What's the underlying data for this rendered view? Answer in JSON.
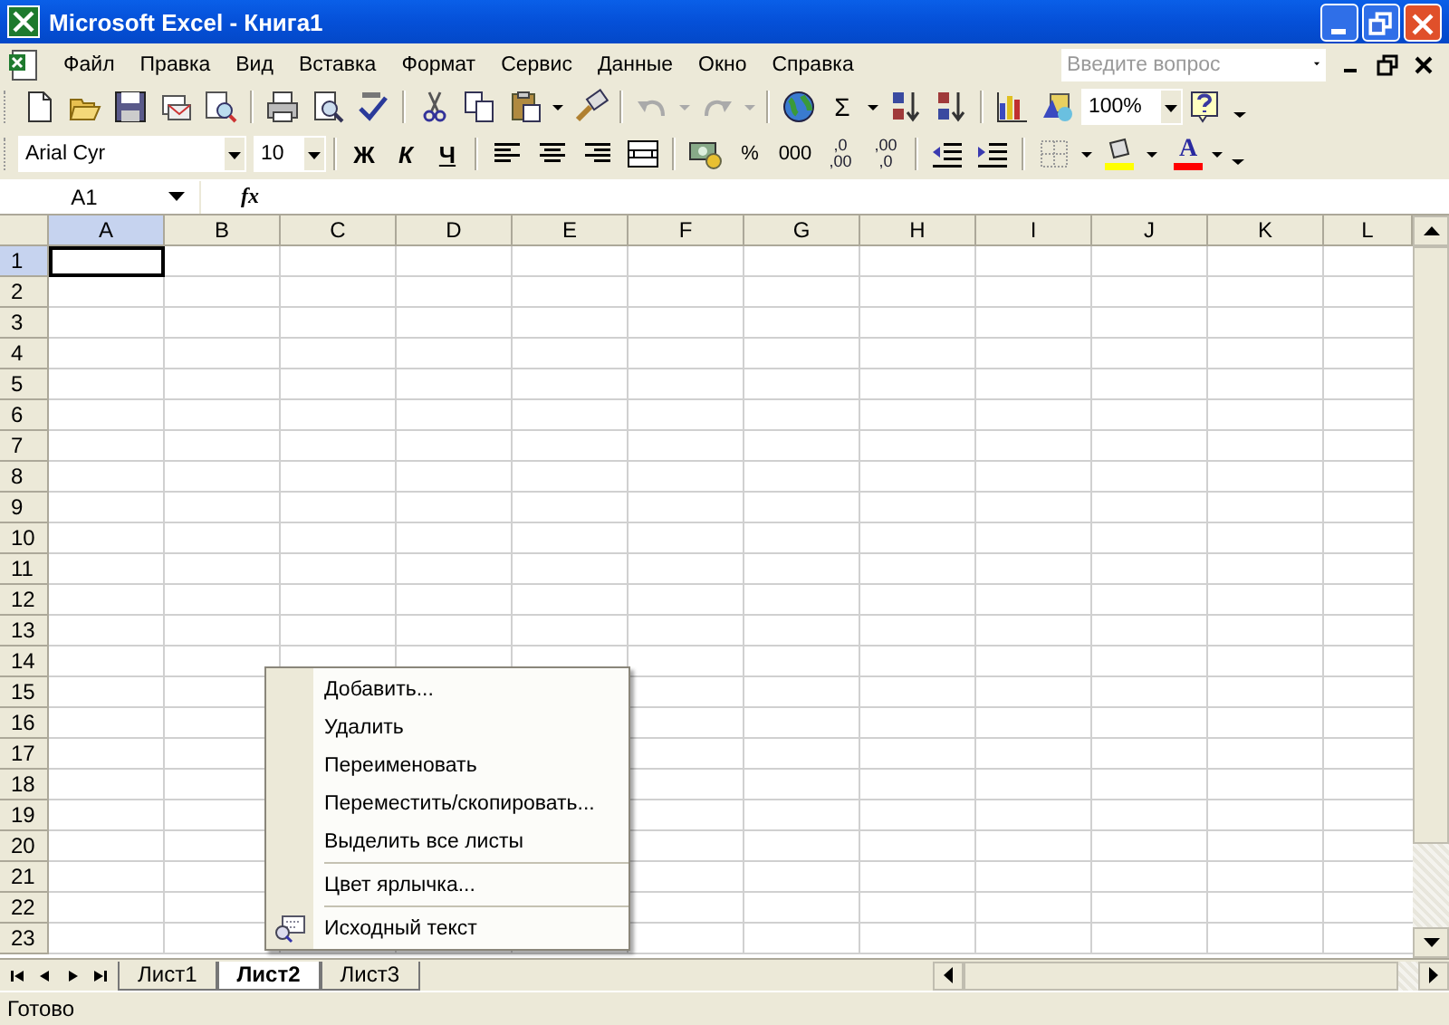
{
  "window": {
    "title": "Microsoft Excel - Книга1"
  },
  "menu": [
    {
      "label": "Файл"
    },
    {
      "label": "Правка"
    },
    {
      "label": "Вид"
    },
    {
      "label": "Вставка"
    },
    {
      "label": "Формат"
    },
    {
      "label": "Сервис"
    },
    {
      "label": "Данные"
    },
    {
      "label": "Окно"
    },
    {
      "label": "Справка"
    }
  ],
  "help_search": {
    "placeholder": "Введите вопрос"
  },
  "standard_toolbar": {
    "autosum": "Σ",
    "zoom": "100%"
  },
  "formatting_toolbar": {
    "font": "Arial Cyr",
    "size": "10",
    "styles": [
      {
        "kind": "bold",
        "label": "Ж"
      },
      {
        "kind": "italic",
        "label": "К"
      },
      {
        "kind": "underline",
        "label": "Ч"
      }
    ],
    "number_formats": [
      {
        "kind": "plain",
        "label": "%"
      },
      {
        "kind": "plain",
        "label": "000"
      },
      {
        "kind": "decimal",
        "label": ",0",
        "sub": ",00"
      },
      {
        "kind": "decimal",
        "label": ",00",
        "sub": ",0"
      }
    ],
    "font_color_label": "A"
  },
  "formula_bar": {
    "name_box": "A1",
    "fx": "fx"
  },
  "columns": [
    {
      "label": "A",
      "selected": true
    },
    {
      "label": "B",
      "selected": false
    },
    {
      "label": "C",
      "selected": false
    },
    {
      "label": "D",
      "selected": false
    },
    {
      "label": "E",
      "selected": false
    },
    {
      "label": "F",
      "selected": false
    },
    {
      "label": "G",
      "selected": false
    },
    {
      "label": "H",
      "selected": false
    },
    {
      "label": "I",
      "selected": false
    },
    {
      "label": "J",
      "selected": false
    },
    {
      "label": "K",
      "selected": false
    },
    {
      "label": "L",
      "selected": false
    }
  ],
  "rows": [
    {
      "label": "1",
      "selected": true
    },
    {
      "label": "2",
      "selected": false
    },
    {
      "label": "3",
      "selected": false
    },
    {
      "label": "4",
      "selected": false
    },
    {
      "label": "5",
      "selected": false
    },
    {
      "label": "6",
      "selected": false
    },
    {
      "label": "7",
      "selected": false
    },
    {
      "label": "8",
      "selected": false
    },
    {
      "label": "9",
      "selected": false
    },
    {
      "label": "10",
      "selected": false
    },
    {
      "label": "11",
      "selected": false
    },
    {
      "label": "12",
      "selected": false
    },
    {
      "label": "13",
      "selected": false
    },
    {
      "label": "14",
      "selected": false
    },
    {
      "label": "15",
      "selected": false
    },
    {
      "label": "16",
      "selected": false
    },
    {
      "label": "17",
      "selected": false
    },
    {
      "label": "18",
      "selected": false
    },
    {
      "label": "19",
      "selected": false
    },
    {
      "label": "20",
      "selected": false
    },
    {
      "label": "21",
      "selected": false
    },
    {
      "label": "22",
      "selected": false
    },
    {
      "label": "23",
      "selected": false
    }
  ],
  "sheet_tabs": [
    {
      "label": "Лист1",
      "selected": false
    },
    {
      "label": "Лист2",
      "selected": true
    },
    {
      "label": "Лист3",
      "selected": false
    }
  ],
  "context_menu": [
    {
      "kind": "item",
      "label": "Добавить..."
    },
    {
      "kind": "item",
      "label": "Удалить"
    },
    {
      "kind": "item",
      "label": "Переименовать"
    },
    {
      "kind": "item",
      "label": "Переместить/скопировать..."
    },
    {
      "kind": "item",
      "label": "Выделить все листы"
    },
    {
      "kind": "separator"
    },
    {
      "kind": "item",
      "label": "Цвет ярлычка..."
    },
    {
      "kind": "separator"
    },
    {
      "kind": "icon_item",
      "label": "Исходный текст"
    }
  ],
  "status_bar": {
    "text": "Готово"
  }
}
